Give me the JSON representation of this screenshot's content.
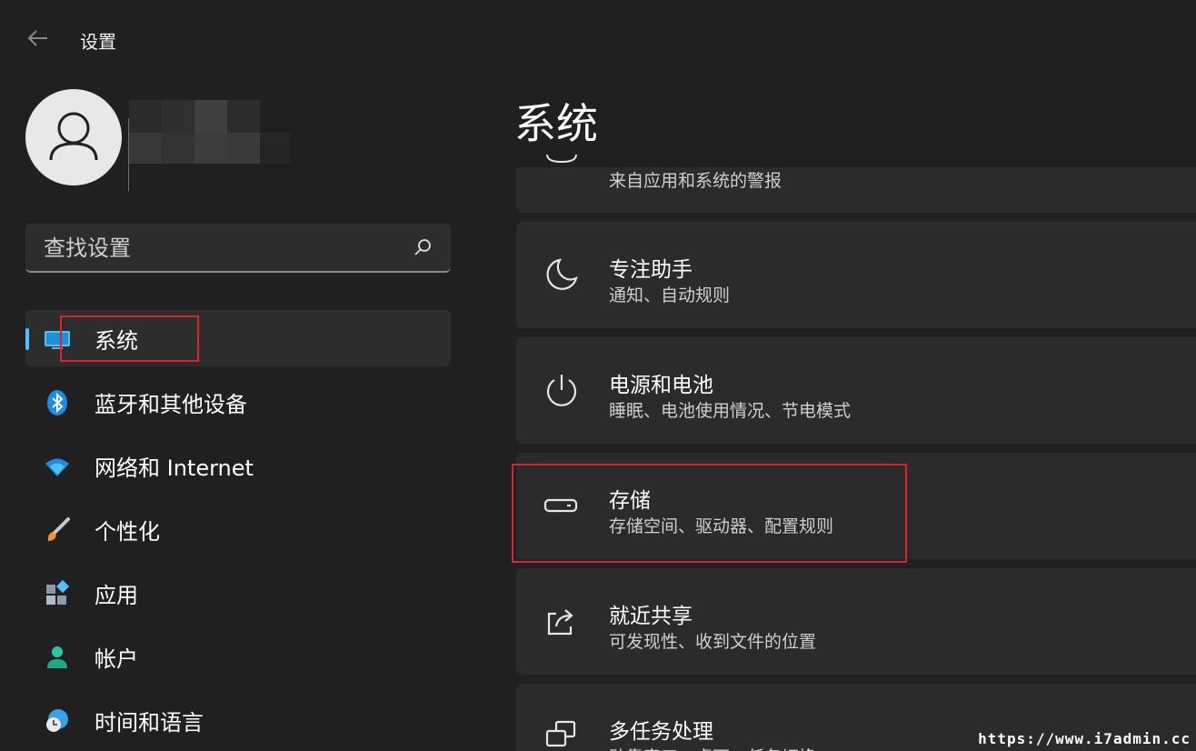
{
  "header": {
    "app_title": "设置"
  },
  "search": {
    "placeholder": "查找设置"
  },
  "nav": {
    "items": [
      {
        "label": "系统",
        "icon": "monitor-icon"
      },
      {
        "label": "蓝牙和其他设备",
        "icon": "bluetooth-icon"
      },
      {
        "label": "网络和 Internet",
        "icon": "wifi-icon"
      },
      {
        "label": "个性化",
        "icon": "paintbrush-icon"
      },
      {
        "label": "应用",
        "icon": "apps-icon"
      },
      {
        "label": "帐户",
        "icon": "person-icon"
      },
      {
        "label": "时间和语言",
        "icon": "globe-clock-icon"
      }
    ],
    "selected": "系统"
  },
  "main": {
    "title": "系统",
    "cards": [
      {
        "title": "",
        "subtitle": "来自应用和系统的警报",
        "icon": "bell-icon"
      },
      {
        "title": "专注助手",
        "subtitle": "通知、自动规则",
        "icon": "moon-icon"
      },
      {
        "title": "电源和电池",
        "subtitle": "睡眠、电池使用情况、节电模式",
        "icon": "power-icon"
      },
      {
        "title": "存储",
        "subtitle": "存储空间、驱动器、配置规则",
        "icon": "drive-icon"
      },
      {
        "title": "就近共享",
        "subtitle": "可发现性、收到文件的位置",
        "icon": "share-icon"
      },
      {
        "title": "多任务处理",
        "subtitle": "贴靠窗口、桌面、任务切换",
        "icon": "multitask-icon"
      }
    ]
  },
  "watermark": "https://www.i7admin.cc",
  "colors": {
    "accent": "#4cc2ff",
    "highlight_box": "#d9252a",
    "background": "#202020",
    "card": "#2b2b2b"
  }
}
